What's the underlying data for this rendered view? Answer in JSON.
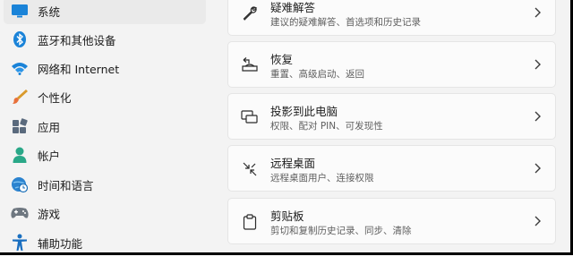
{
  "sidebar": {
    "items": [
      {
        "label": "系统",
        "icon": "monitor-icon",
        "selected": true
      },
      {
        "label": "蓝牙和其他设备",
        "icon": "bluetooth-icon"
      },
      {
        "label": "网络和 Internet",
        "icon": "wifi-icon"
      },
      {
        "label": "个性化",
        "icon": "brush-icon"
      },
      {
        "label": "应用",
        "icon": "apps-icon"
      },
      {
        "label": "帐户",
        "icon": "person-icon"
      },
      {
        "label": "时间和语言",
        "icon": "globe-clock-icon"
      },
      {
        "label": "游戏",
        "icon": "gamepad-icon"
      },
      {
        "label": "辅助功能",
        "icon": "accessibility-icon"
      }
    ]
  },
  "cards": [
    {
      "title": "疑难解答",
      "desc": "建议的疑难解答、首选项和历史记录",
      "icon": "wrench-icon"
    },
    {
      "title": "恢复",
      "desc": "重置、高级启动、返回",
      "icon": "recovery-icon"
    },
    {
      "title": "投影到此电脑",
      "desc": "权限、配对 PIN、可发现性",
      "icon": "projection-icon"
    },
    {
      "title": "远程桌面",
      "desc": "远程桌面用户、连接权限",
      "icon": "remote-desktop-icon"
    },
    {
      "title": "剪贴板",
      "desc": "剪切和复制历史记录、同步、清除",
      "icon": "clipboard-icon"
    }
  ],
  "colors": {
    "accent": "#0067c0",
    "selected_bg": "#eaeaea",
    "card_bg": "#fbfbfb"
  }
}
